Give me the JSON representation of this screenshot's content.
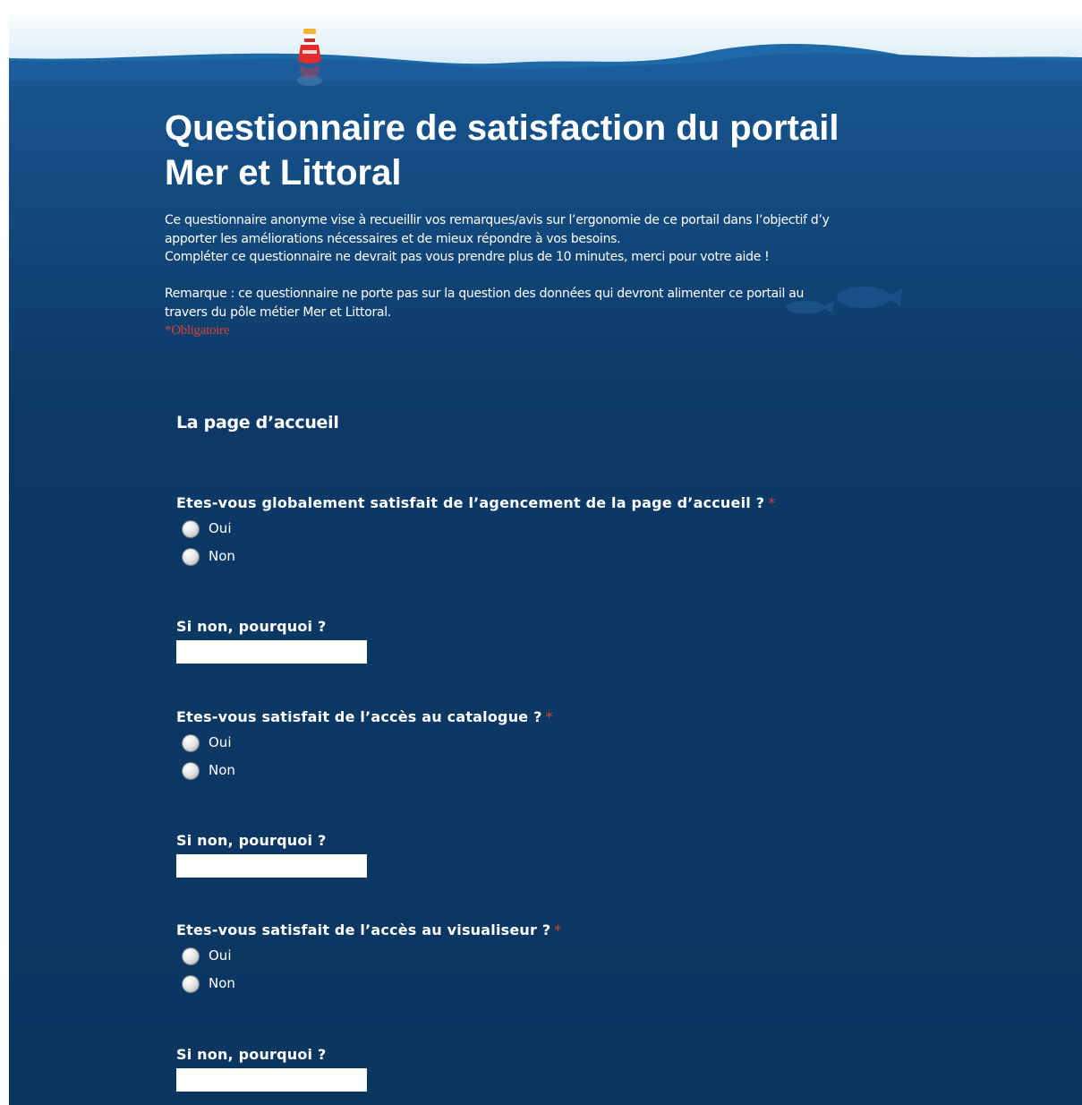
{
  "header": {
    "title_line1": "Questionnaire de satisfaction du portail",
    "title_line2": "Mer et Littoral",
    "description": [
      "Ce questionnaire anonyme vise à recueillir vos remarques/avis sur l’ergonomie de ce portail dans l’objectif d’y",
      "apporter les améliorations nécessaires et de mieux répondre à vos besoins.",
      "Compléter ce questionnaire ne devrait pas vous prendre plus de 10 minutes, merci pour votre aide !"
    ],
    "remark": [
      "Remarque : ce questionnaire ne porte pas sur la question des données qui devront alimenter ce portail au",
      "travers du pôle métier Mer et Littoral."
    ],
    "required_note": "*Obligatoire"
  },
  "section": {
    "title": "La page d’accueil"
  },
  "questions": [
    {
      "label": "Etes-vous globalement satisfait de l’agencement de la page d’accueil ?",
      "required_mark": "*",
      "options": [
        "Oui",
        "Non"
      ]
    },
    {
      "label": "Si non, pourquoi ?",
      "value": ""
    },
    {
      "label": "Etes-vous satisfait de l’accès au catalogue ?",
      "required_mark": "*",
      "options": [
        "Oui",
        "Non"
      ]
    },
    {
      "label": "Si non, pourquoi ?",
      "value": ""
    },
    {
      "label": "Etes-vous satisfait de l’accès au visualiseur ?",
      "required_mark": "*",
      "options": [
        "Oui",
        "Non"
      ]
    },
    {
      "label": "Si non, pourquoi ?",
      "value": ""
    }
  ],
  "colors": {
    "ocean_top": "#1b5b96",
    "ocean_bottom": "#0b3660",
    "required": "#d84234",
    "text": "#ffffff"
  }
}
